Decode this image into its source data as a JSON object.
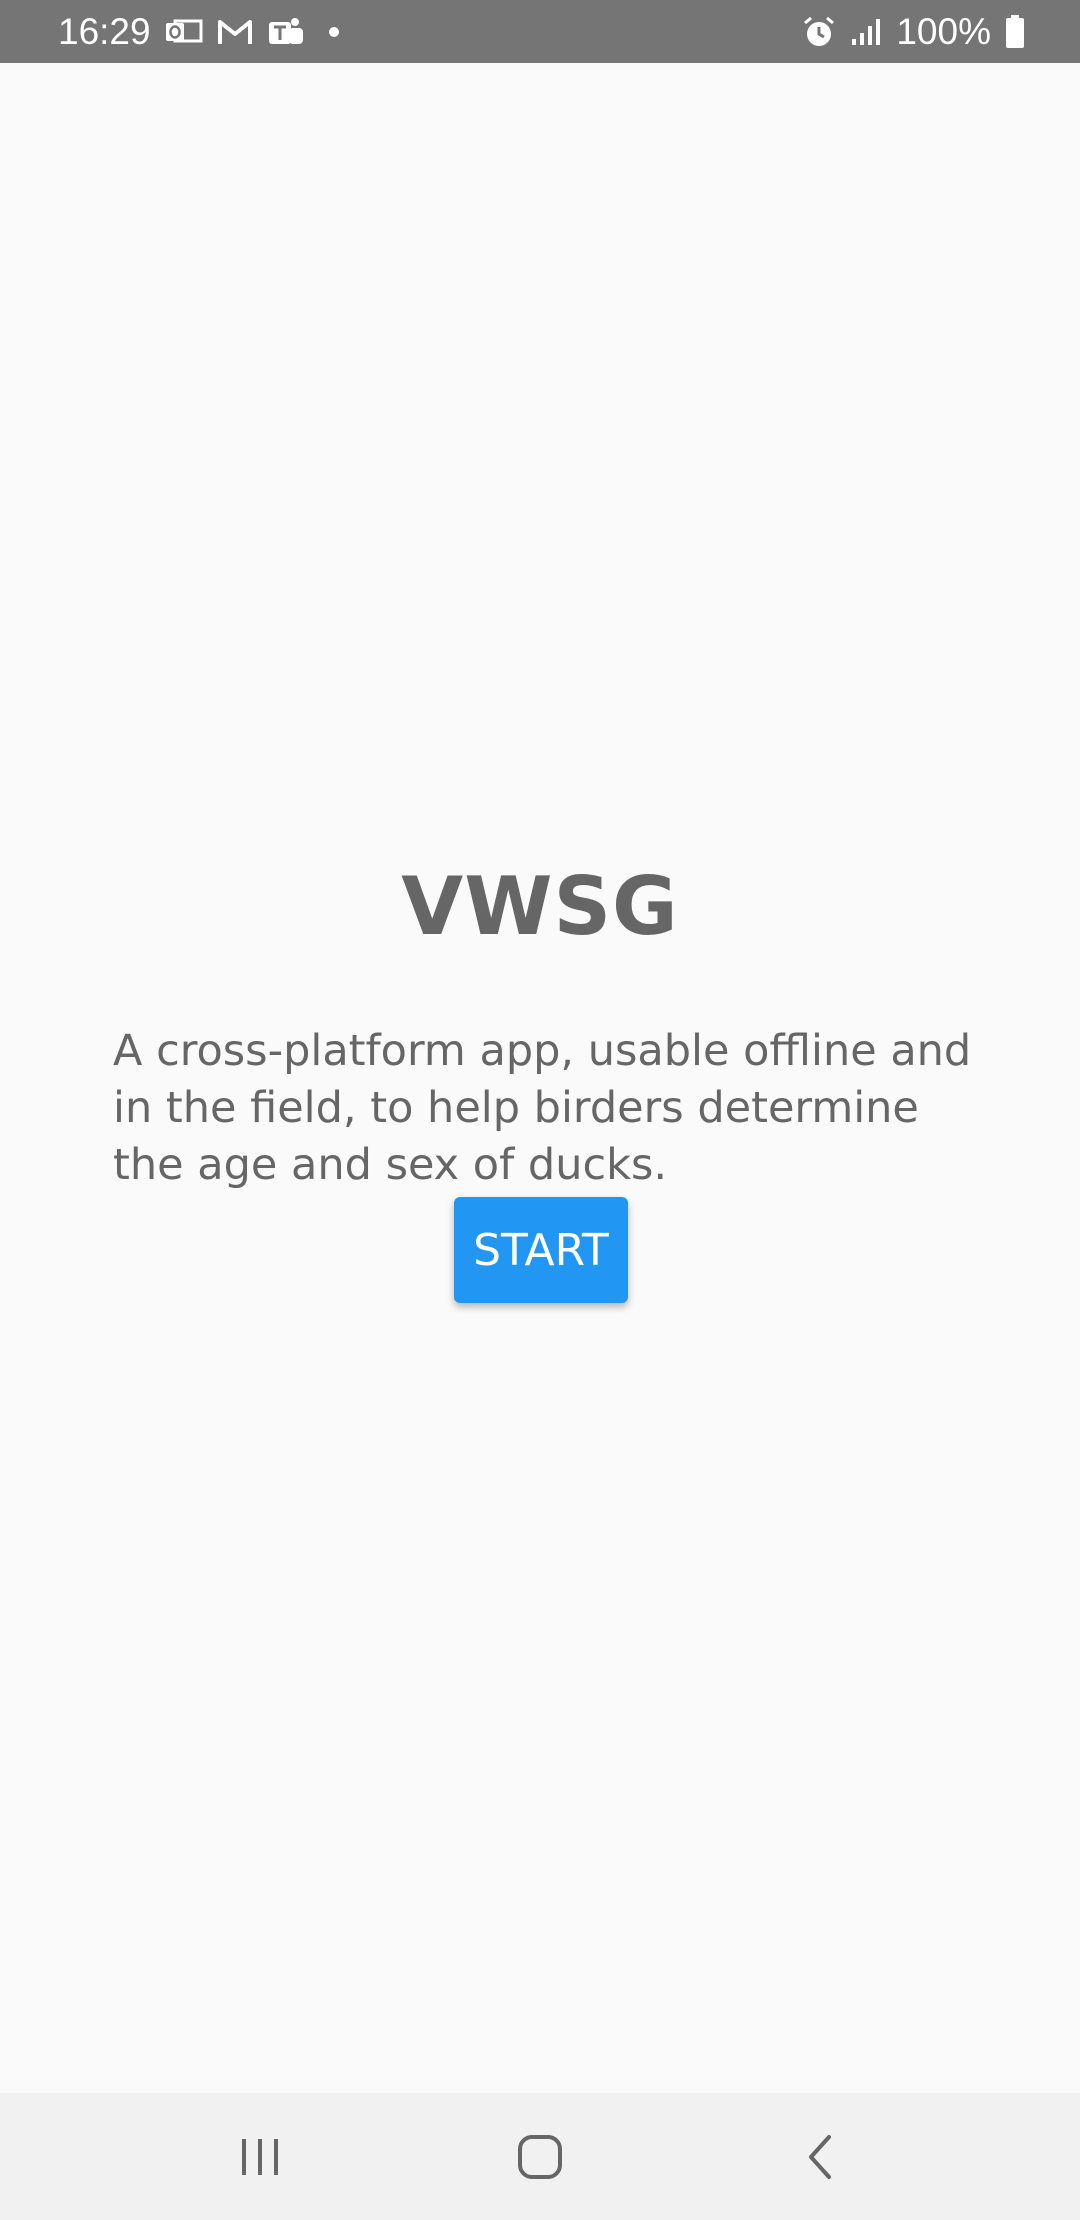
{
  "status_bar": {
    "time": "16:29",
    "battery": "100%",
    "left_icons": [
      "outlook-icon",
      "gmail-icon",
      "teams-icon",
      "notification-dot"
    ],
    "right_icons": [
      "alarm-icon",
      "signal-icon",
      "battery-icon"
    ]
  },
  "app": {
    "title": "VWSG",
    "description": "A cross-platform app, usable offline and in the field, to help birders determine the age and sex of ducks.",
    "start_label": "START"
  },
  "nav_bar": {
    "buttons": [
      "recent-apps",
      "home",
      "back"
    ]
  },
  "colors": {
    "status_bar": "#757575",
    "background": "#fafafa",
    "text": "#666666",
    "accent": "#2196f3",
    "nav_bar": "#f1f1f1"
  }
}
